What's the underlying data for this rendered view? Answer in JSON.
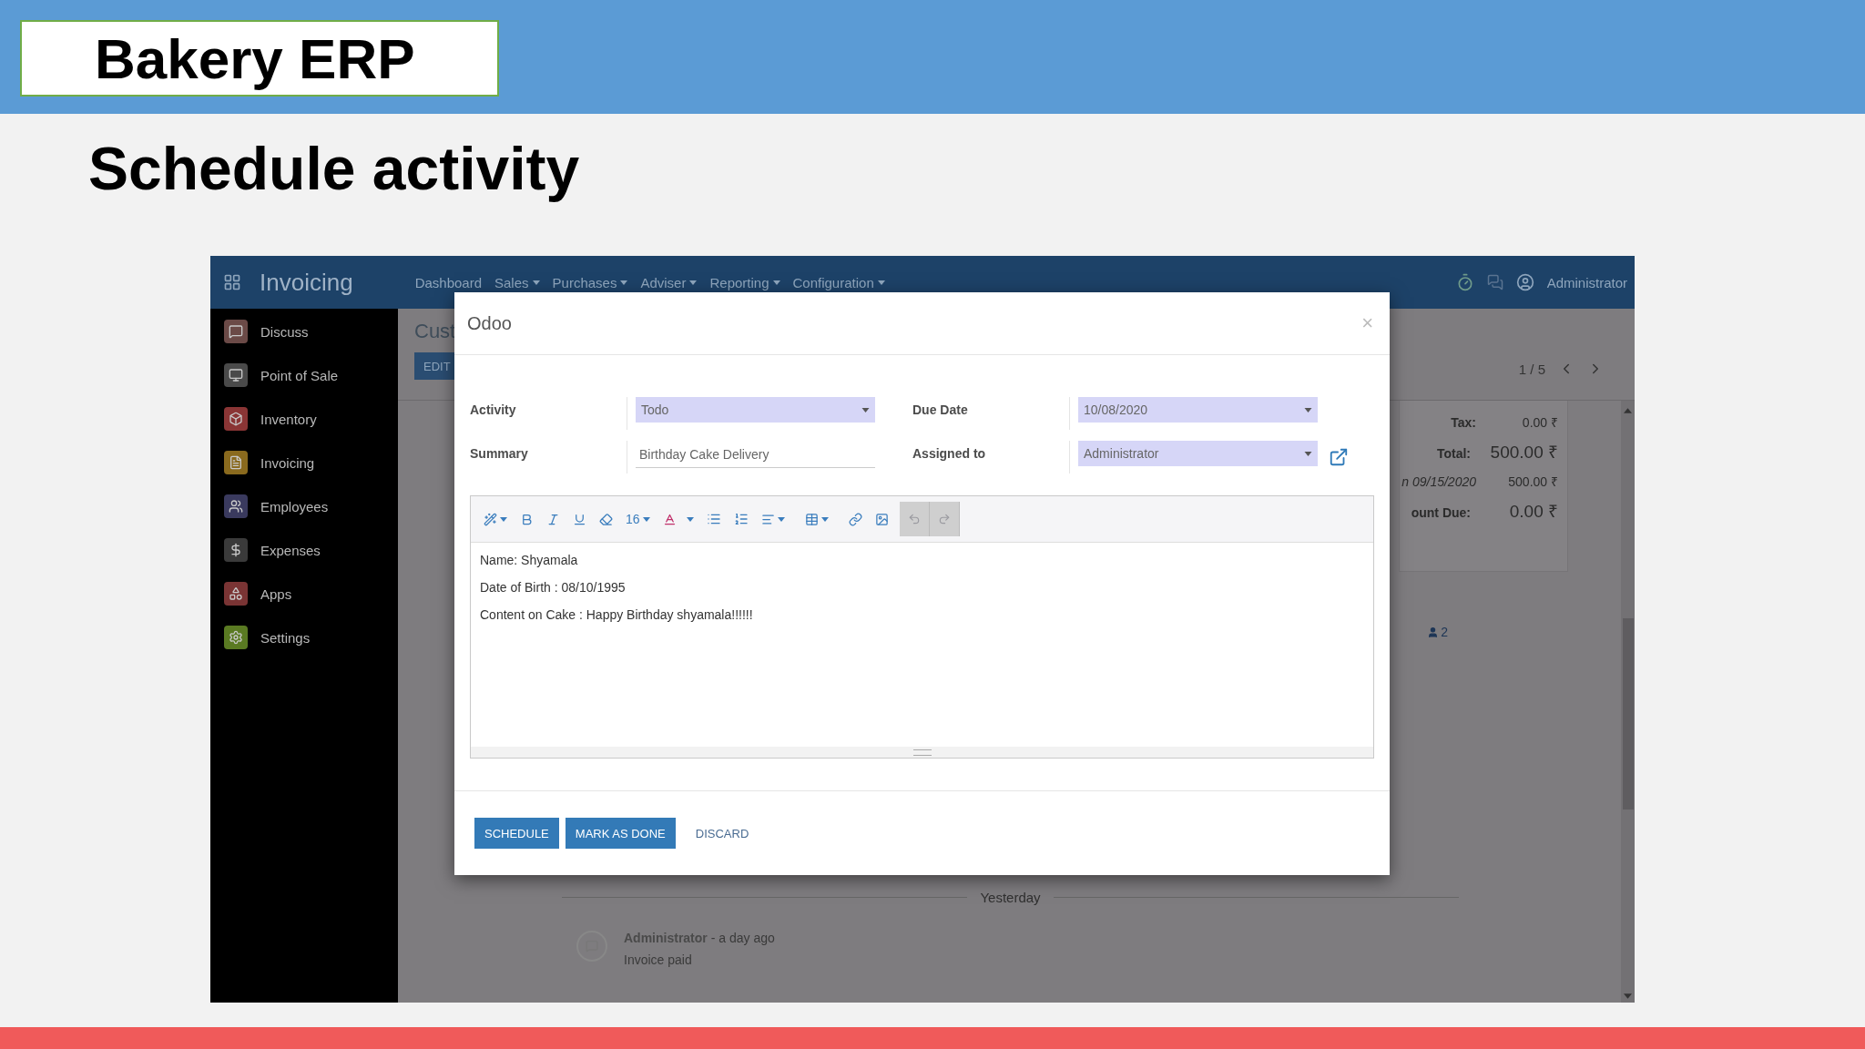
{
  "slide": {
    "title": "Bakery ERP",
    "heading": "Schedule activity"
  },
  "app": {
    "brand": "Invoicing",
    "menu": [
      {
        "label": "Dashboard",
        "dropdown": false
      },
      {
        "label": "Sales",
        "dropdown": true
      },
      {
        "label": "Purchases",
        "dropdown": true
      },
      {
        "label": "Adviser",
        "dropdown": true
      },
      {
        "label": "Reporting",
        "dropdown": true
      },
      {
        "label": "Configuration",
        "dropdown": true
      }
    ],
    "user": "Administrator",
    "sidebar": [
      {
        "label": "Discuss",
        "kind": "chat",
        "color": "#6b4a47"
      },
      {
        "label": "Point of Sale",
        "kind": "monitor",
        "color": "#4a4a4a"
      },
      {
        "label": "Inventory",
        "kind": "box",
        "color": "#8a3535"
      },
      {
        "label": "Invoicing",
        "kind": "file",
        "color": "#8a6a1e"
      },
      {
        "label": "Employees",
        "kind": "users",
        "color": "#3a3a5e"
      },
      {
        "label": "Expenses",
        "kind": "dollar",
        "color": "#3a3a3a"
      },
      {
        "label": "Apps",
        "kind": "apps",
        "color": "#7a3434"
      },
      {
        "label": "Settings",
        "kind": "gear",
        "color": "#5a7a22"
      }
    ]
  },
  "background": {
    "title_fragment": "Cust",
    "edit_button": "EDIT",
    "pager": "1 / 5",
    "totals": [
      {
        "label": "Tax:",
        "value": "0.00 ₹",
        "kind": "plain"
      },
      {
        "label": "Total:",
        "value": "500.00 ₹",
        "kind": "big"
      },
      {
        "label": "n 09/15/2020",
        "value": "500.00 ₹",
        "kind": "payment"
      },
      {
        "label": "ount Due:",
        "value": "0.00 ₹",
        "kind": "big"
      }
    ],
    "followers": "2",
    "divider": "Yesterday",
    "message": {
      "author": "Administrator",
      "time": "- a day ago",
      "body": "Invoice paid"
    }
  },
  "dialog": {
    "title": "Odoo",
    "close": "×",
    "fields_left": [
      {
        "label": "Activity",
        "value": "Todo",
        "kind": "select"
      },
      {
        "label": "Summary",
        "value": "Birthday Cake Delivery",
        "kind": "input"
      }
    ],
    "fields_right": [
      {
        "label": "Due Date",
        "value": "10/08/2020",
        "kind": "select"
      },
      {
        "label": "Assigned to",
        "value": "Administrator",
        "kind": "select",
        "link": true
      }
    ],
    "font_size": "16",
    "history": [
      {
        "kind": "undo",
        "disabled": true
      },
      {
        "kind": "redo",
        "disabled": true
      }
    ],
    "lines": [
      "Name: Shyamala",
      "Date of Birth : 08/10/1995",
      "Content on Cake : Happy Birthday shyamala!!!!!!"
    ],
    "buttons": [
      {
        "label": "SCHEDULE",
        "kind": "primary"
      },
      {
        "label": "MARK AS DONE",
        "kind": "primary"
      },
      {
        "label": "DISCARD",
        "kind": "link"
      }
    ]
  }
}
